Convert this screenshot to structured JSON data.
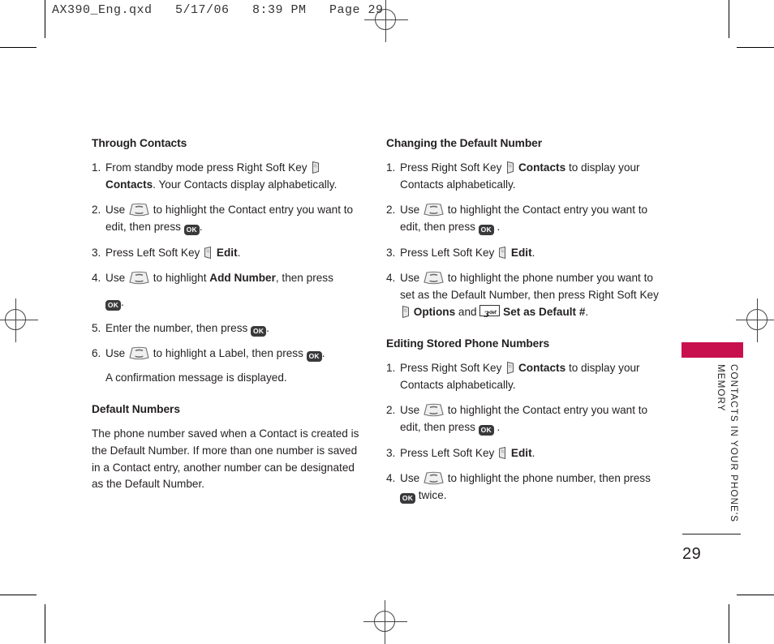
{
  "printer_slug": "AX390_Eng.qxd   5/17/06   8:39 PM   Page 29",
  "colors": {
    "tab_accent": "#C8104E",
    "text": "#231f20",
    "ok_key_fill": "#3a3a3c"
  },
  "left_column": {
    "heading_1": "Through Contacts",
    "steps": [
      {
        "num": "1.",
        "part_a": "From standby mode press Right Soft Key",
        "icon": "right-soft-key-icon",
        "bold_b": "Contacts",
        "part_c": ". Your Contacts display alphabetically."
      },
      {
        "num": "2.",
        "part_a": "Use",
        "icon": "navigation-pad-icon",
        "part_b": "to highlight the Contact entry you want to edit, then press",
        "icon_2": "ok-key-icon",
        "part_c": "."
      },
      {
        "num": "3.",
        "part_a": "Press Left Soft Key",
        "icon": "left-soft-key-icon",
        "bold_b": "Edit",
        "part_c": "."
      },
      {
        "num": "4.",
        "part_a": "Use",
        "icon": "navigation-pad-icon",
        "part_b": "to highlight",
        "bold_b": "Add Number",
        "part_c": ", then press",
        "icon_2": "ok-key-icon",
        "part_d": "."
      },
      {
        "num": "5.",
        "part_a": "Enter the number, then press",
        "icon": "ok-key-icon",
        "part_b": "."
      },
      {
        "num": "6.",
        "part_a": "Use",
        "icon": "navigation-pad-icon",
        "part_b": "to highlight a Label, then press",
        "icon_2": "ok-key-icon",
        "part_c": ".",
        "note": "A confirmation message is displayed."
      }
    ],
    "heading_2": "Default Numbers",
    "paragraph": "The phone number saved when a Contact is created is the Default Number. If more than one number is saved in a Contact entry, another number can be designated as the Default Number."
  },
  "right_column": {
    "heading_1": "Changing the Default Number",
    "steps_1": [
      {
        "num": "1.",
        "part_a": "Press Right Soft Key",
        "icon": "right-soft-key-icon",
        "bold_b": "Contacts",
        "part_c": "to display your Contacts alphabetically."
      },
      {
        "num": "2.",
        "part_a": "Use",
        "icon": "navigation-pad-icon",
        "part_b": "to highlight the Contact entry you want to edit, then press",
        "icon_2": "ok-key-icon",
        "part_c": "."
      },
      {
        "num": "3.",
        "part_a": "Press Left Soft Key",
        "icon": "left-soft-key-icon",
        "bold_b": "Edit",
        "part_c": "."
      },
      {
        "num": "4.",
        "part_a": "Use",
        "icon": "navigation-pad-icon",
        "part_b": "to highlight the phone number you want to set as the Default Number, then press  Right Soft Key",
        "icon_2": "right-soft-key-icon",
        "bold_b": "Options",
        "part_c": "and",
        "icon_3": "key-3-def-icon",
        "key3_digit": "3",
        "key3_letters": "def",
        "bold_d": "Set as Default #",
        "part_e": "."
      }
    ],
    "heading_2": "Editing Stored Phone Numbers",
    "steps_2": [
      {
        "num": "1.",
        "part_a": "Press Right Soft Key",
        "icon": "right-soft-key-icon",
        "bold_b": "Contacts",
        "part_c": "to display your Contacts alphabetically."
      },
      {
        "num": "2.",
        "part_a": "Use",
        "icon": "navigation-pad-icon",
        "part_b": "to highlight the Contact entry you want to edit, then press",
        "icon_2": "ok-key-icon",
        "part_c": "."
      },
      {
        "num": "3.",
        "part_a": "Press Left Soft Key",
        "icon": "left-soft-key-icon",
        "bold_b": "Edit",
        "part_c": "."
      },
      {
        "num": "4.",
        "part_a": "Use",
        "icon": "navigation-pad-icon",
        "part_b": "to highlight the phone number, then press",
        "icon_2": "ok-key-icon",
        "part_c": "twice."
      }
    ]
  },
  "side_tab": {
    "label": "CONTACTS IN YOUR PHONE'S MEMORY"
  },
  "folio": {
    "page_number": "29"
  }
}
